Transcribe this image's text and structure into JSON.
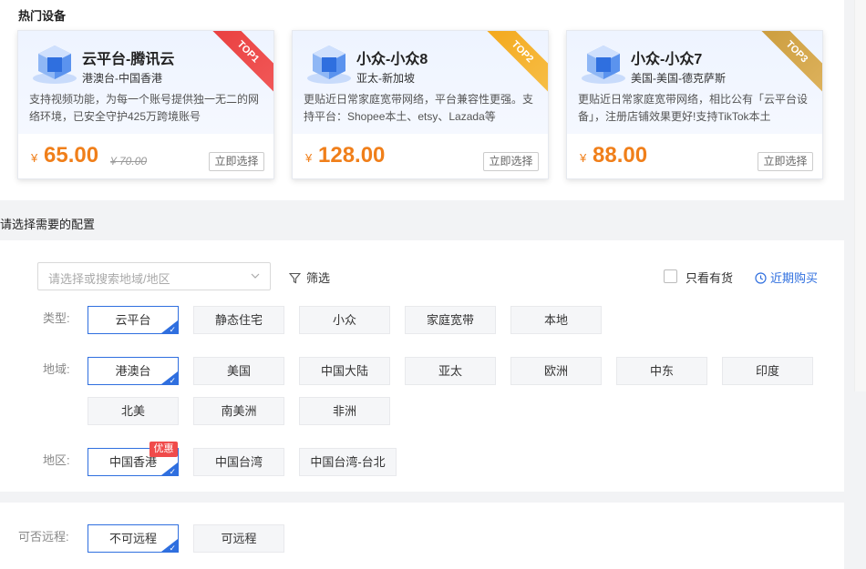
{
  "hot": {
    "title": "热门设备",
    "cards": [
      {
        "name": "云平台-腾讯云",
        "region": "港澳台-中国香港",
        "desc": "支持视频功能，为每一个账号提供独一无二的网络环境，已安全守护425万跨境账号",
        "rank": "TOP1",
        "currency": "¥",
        "price": "65.00",
        "old_price": "¥ 70.00",
        "button": "立即选择"
      },
      {
        "name": "小众-小众8",
        "region": "亚太-新加坡",
        "desc": "更贴近日常家庭宽带网络，平台兼容性更强。支持平台：Shopee本土、etsy、Lazada等",
        "rank": "TOP2",
        "currency": "¥",
        "price": "128.00",
        "old_price": "",
        "button": "立即选择"
      },
      {
        "name": "小众-小众7",
        "region": "美国-美国-德克萨斯",
        "desc": "更贴近日常家庭宽带网络，相比公有「云平台设备」，注册店铺效果更好!支持TikTok本土",
        "rank": "TOP3",
        "currency": "¥",
        "price": "88.00",
        "old_price": "",
        "button": "立即选择"
      }
    ]
  },
  "config": {
    "title": "请选择需要的配置",
    "search_placeholder": "请选择或搜索地域/地区",
    "filter_label": "筛选",
    "in_stock_label": "只看有货",
    "recent_label": "近期购买",
    "type": {
      "label": "类型:",
      "options": [
        "云平台",
        "静态住宅",
        "小众",
        "家庭宽带",
        "本地"
      ],
      "selected": "云平台"
    },
    "area": {
      "label": "地域:",
      "options": [
        "港澳台",
        "美国",
        "中国大陆",
        "亚太",
        "欧洲",
        "中东",
        "印度",
        "北美",
        "南美洲",
        "非洲"
      ],
      "selected": "港澳台"
    },
    "region": {
      "label": "地区:",
      "options": [
        "中国香港",
        "中国台湾",
        "中国台湾-台北"
      ],
      "selected": "中国香港",
      "badge": "优惠"
    }
  },
  "remote": {
    "label": "可否远程:",
    "options": [
      "不可远程",
      "可远程"
    ],
    "selected": "不可远程"
  },
  "colors": {
    "accent": "#2f6fdf",
    "price": "#f07f1a",
    "top1": "#e83c3c",
    "top2": "#f3a516",
    "top3": "#c99a3a"
  }
}
